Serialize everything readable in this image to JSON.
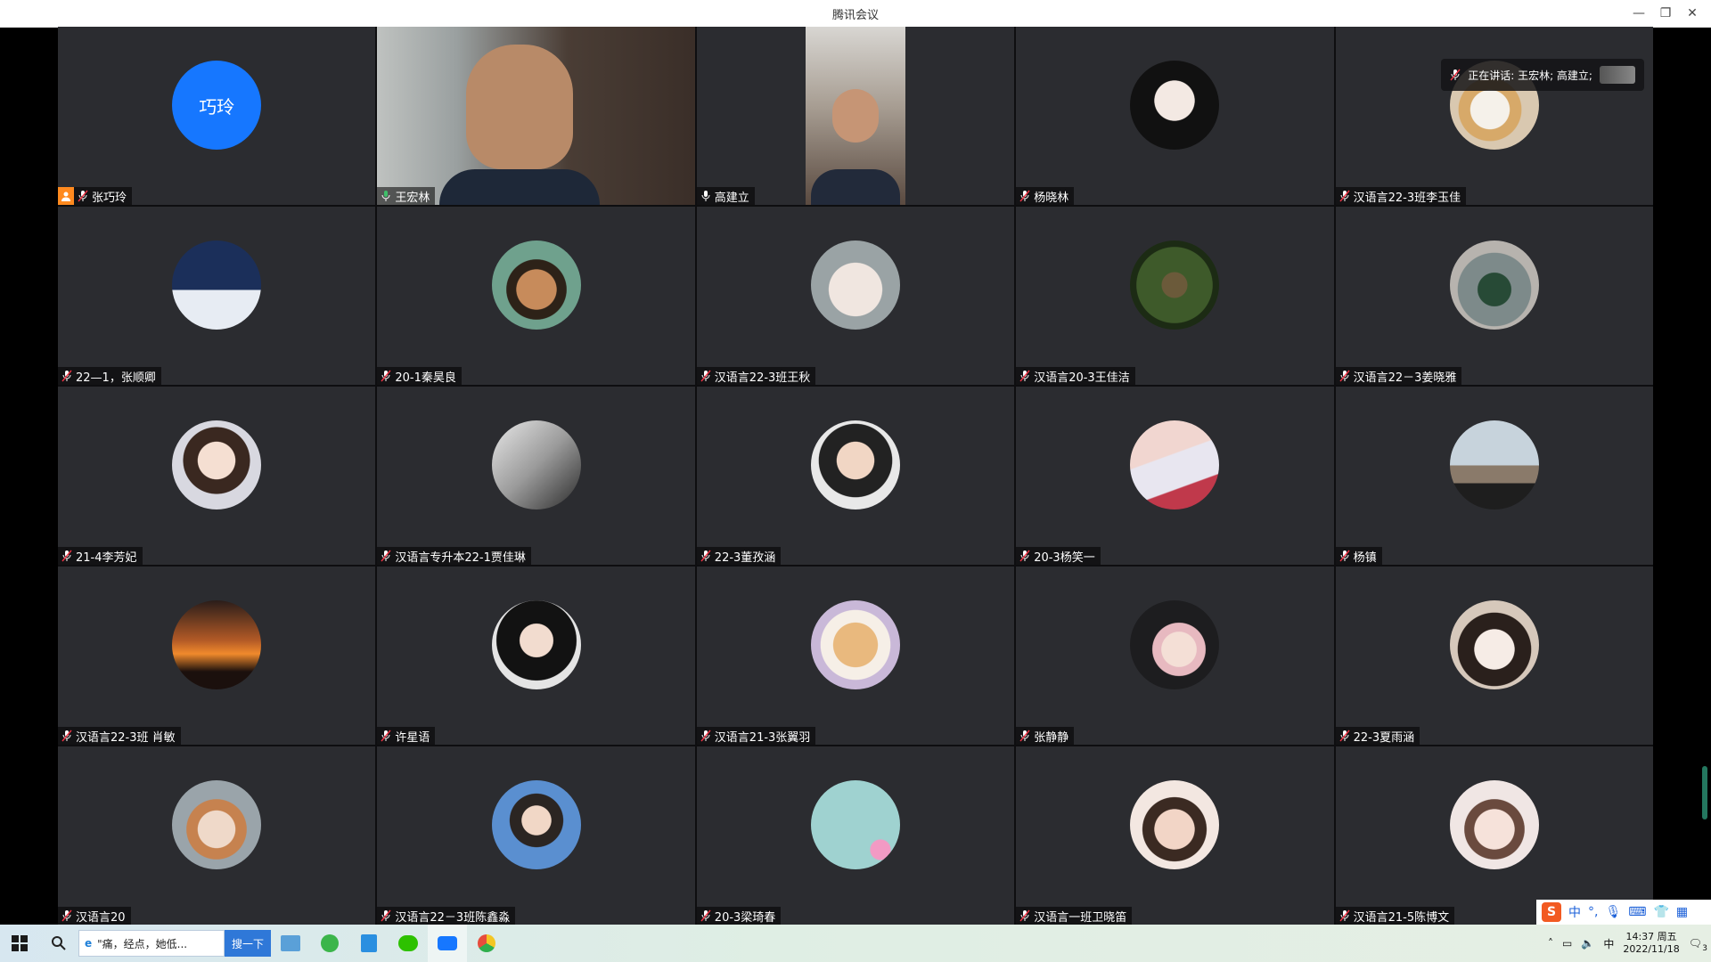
{
  "window": {
    "title": "腾讯会议"
  },
  "speaking": {
    "label": "正在讲话: 王宏林; 高建立;"
  },
  "participants": [
    {
      "name": "张巧玲",
      "avatar_text": "巧玲",
      "host": true
    },
    {
      "name": "王宏林",
      "video": true,
      "active": true,
      "mic_on": true
    },
    {
      "name": "高建立",
      "video": true,
      "mic_on": true
    },
    {
      "name": "杨晓林"
    },
    {
      "name": "汉语言22-3班李玉佳"
    },
    {
      "name": "22—1，张顺卿"
    },
    {
      "name": "20-1秦昊良"
    },
    {
      "name": "汉语言22-3班王秋"
    },
    {
      "name": "汉语言20-3王佳洁"
    },
    {
      "name": "汉语言22－3姜晓雅"
    },
    {
      "name": "21-4李芳妃"
    },
    {
      "name": "汉语言专升本22-1贾佳琳"
    },
    {
      "name": "22-3董孜涵"
    },
    {
      "name": "20-3杨笑一"
    },
    {
      "name": "杨镇"
    },
    {
      "name": "汉语言22-3班  肖敏"
    },
    {
      "name": "许星语"
    },
    {
      "name": "汉语言21-3张翼羽"
    },
    {
      "name": "张静静"
    },
    {
      "name": "22-3夏雨涵"
    },
    {
      "name": "汉语言20"
    },
    {
      "name": "汉语言22－3班陈鑫淼"
    },
    {
      "name": "20-3梁琦春"
    },
    {
      "name": "汉语言一班卫晓笛"
    },
    {
      "name": "汉语言21-5陈博文"
    }
  ],
  "taskbar": {
    "search_text": "\"痛，经点，她低...",
    "search_button": "搜一下",
    "time": "14:37 周五",
    "date": "2022/11/18",
    "notif_count": "3",
    "ime_label": "中"
  },
  "colors": {
    "accent": "#1677ff",
    "active_border": "#3fbf6a",
    "host_badge": "#ff8a1f"
  }
}
